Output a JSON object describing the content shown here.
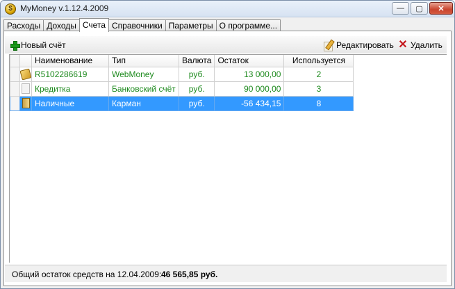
{
  "window": {
    "title": "MyMoney v.1.12.4.2009",
    "buttons": {
      "minimize": "—",
      "maximize": "▢",
      "close": "✕"
    }
  },
  "tabs": [
    {
      "label": "Расходы",
      "active": false
    },
    {
      "label": "Доходы",
      "active": false
    },
    {
      "label": "Счета",
      "active": true
    },
    {
      "label": "Справочники",
      "active": false
    },
    {
      "label": "Параметры",
      "active": false
    },
    {
      "label": "О программе...",
      "active": false
    }
  ],
  "toolbar": {
    "add_label": "Новый счёт",
    "edit_label": "Редактировать",
    "delete_label": "Удалить"
  },
  "table": {
    "columns": [
      "Наименование",
      "Тип",
      "Валюта",
      "Остаток",
      "Используется"
    ],
    "rows": [
      {
        "icon": "webmoney-icon",
        "name": "R5102286619",
        "type": "WebMoney",
        "currency": "руб.",
        "balance": "13 000,00",
        "used": "2",
        "selected": false
      },
      {
        "icon": "card-icon",
        "name": "Кредитка",
        "type": "Банковский счёт",
        "currency": "руб.",
        "balance": "90 000,00",
        "used": "3",
        "selected": false
      },
      {
        "icon": "wallet-icon",
        "name": "Наличные",
        "type": "Карман",
        "currency": "руб.",
        "balance": "-56 434,15",
        "used": "8",
        "selected": true
      }
    ]
  },
  "status": {
    "label": "Общий остаток средств на 12.04.2009:",
    "total": "46 565,85 руб."
  },
  "colors": {
    "selection": "#3399ff",
    "positive_text": "#1e8a1e"
  }
}
